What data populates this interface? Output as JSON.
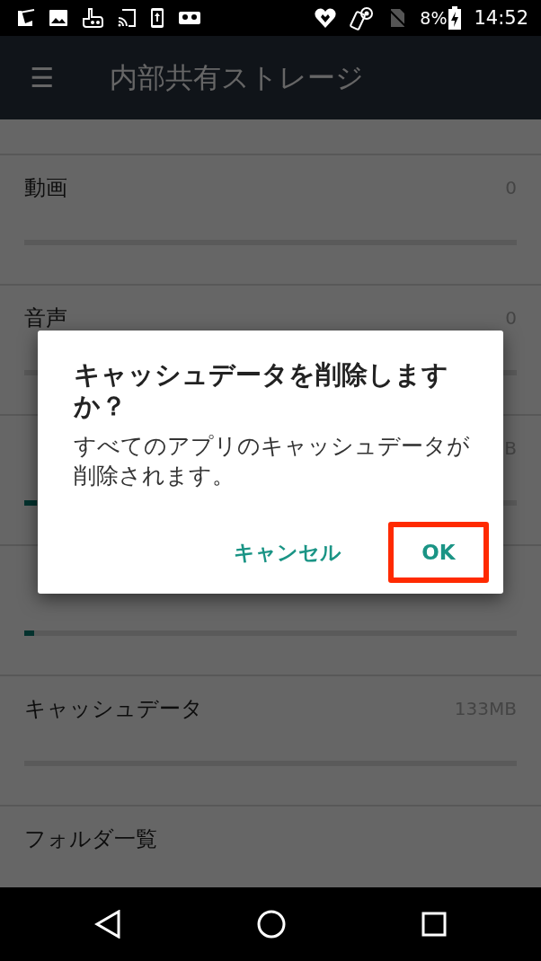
{
  "status_bar": {
    "battery": "8%",
    "time": "14:52"
  },
  "app_bar": {
    "menu_icon": "☰",
    "title": "内部共有ストレージ"
  },
  "rows": [
    {
      "label": "動画",
      "value": "0",
      "level": 0
    },
    {
      "label": "音声",
      "value": "0",
      "level": 0
    },
    {
      "value": "B",
      "level": 0.025
    },
    {
      "level": 0.02
    },
    {
      "label": "キャッシュデータ",
      "value": "133MB",
      "level": 0
    },
    {
      "label": "フォルダ一覧"
    }
  ],
  "dialog": {
    "title": "キャッシュデータを削除しますか？",
    "message": "すべてのアプリのキャッシュデータが削除されます。",
    "buttons": [
      {
        "label": "キャンセル",
        "highlighted": false
      },
      {
        "label": "OK",
        "highlighted": true
      }
    ]
  }
}
